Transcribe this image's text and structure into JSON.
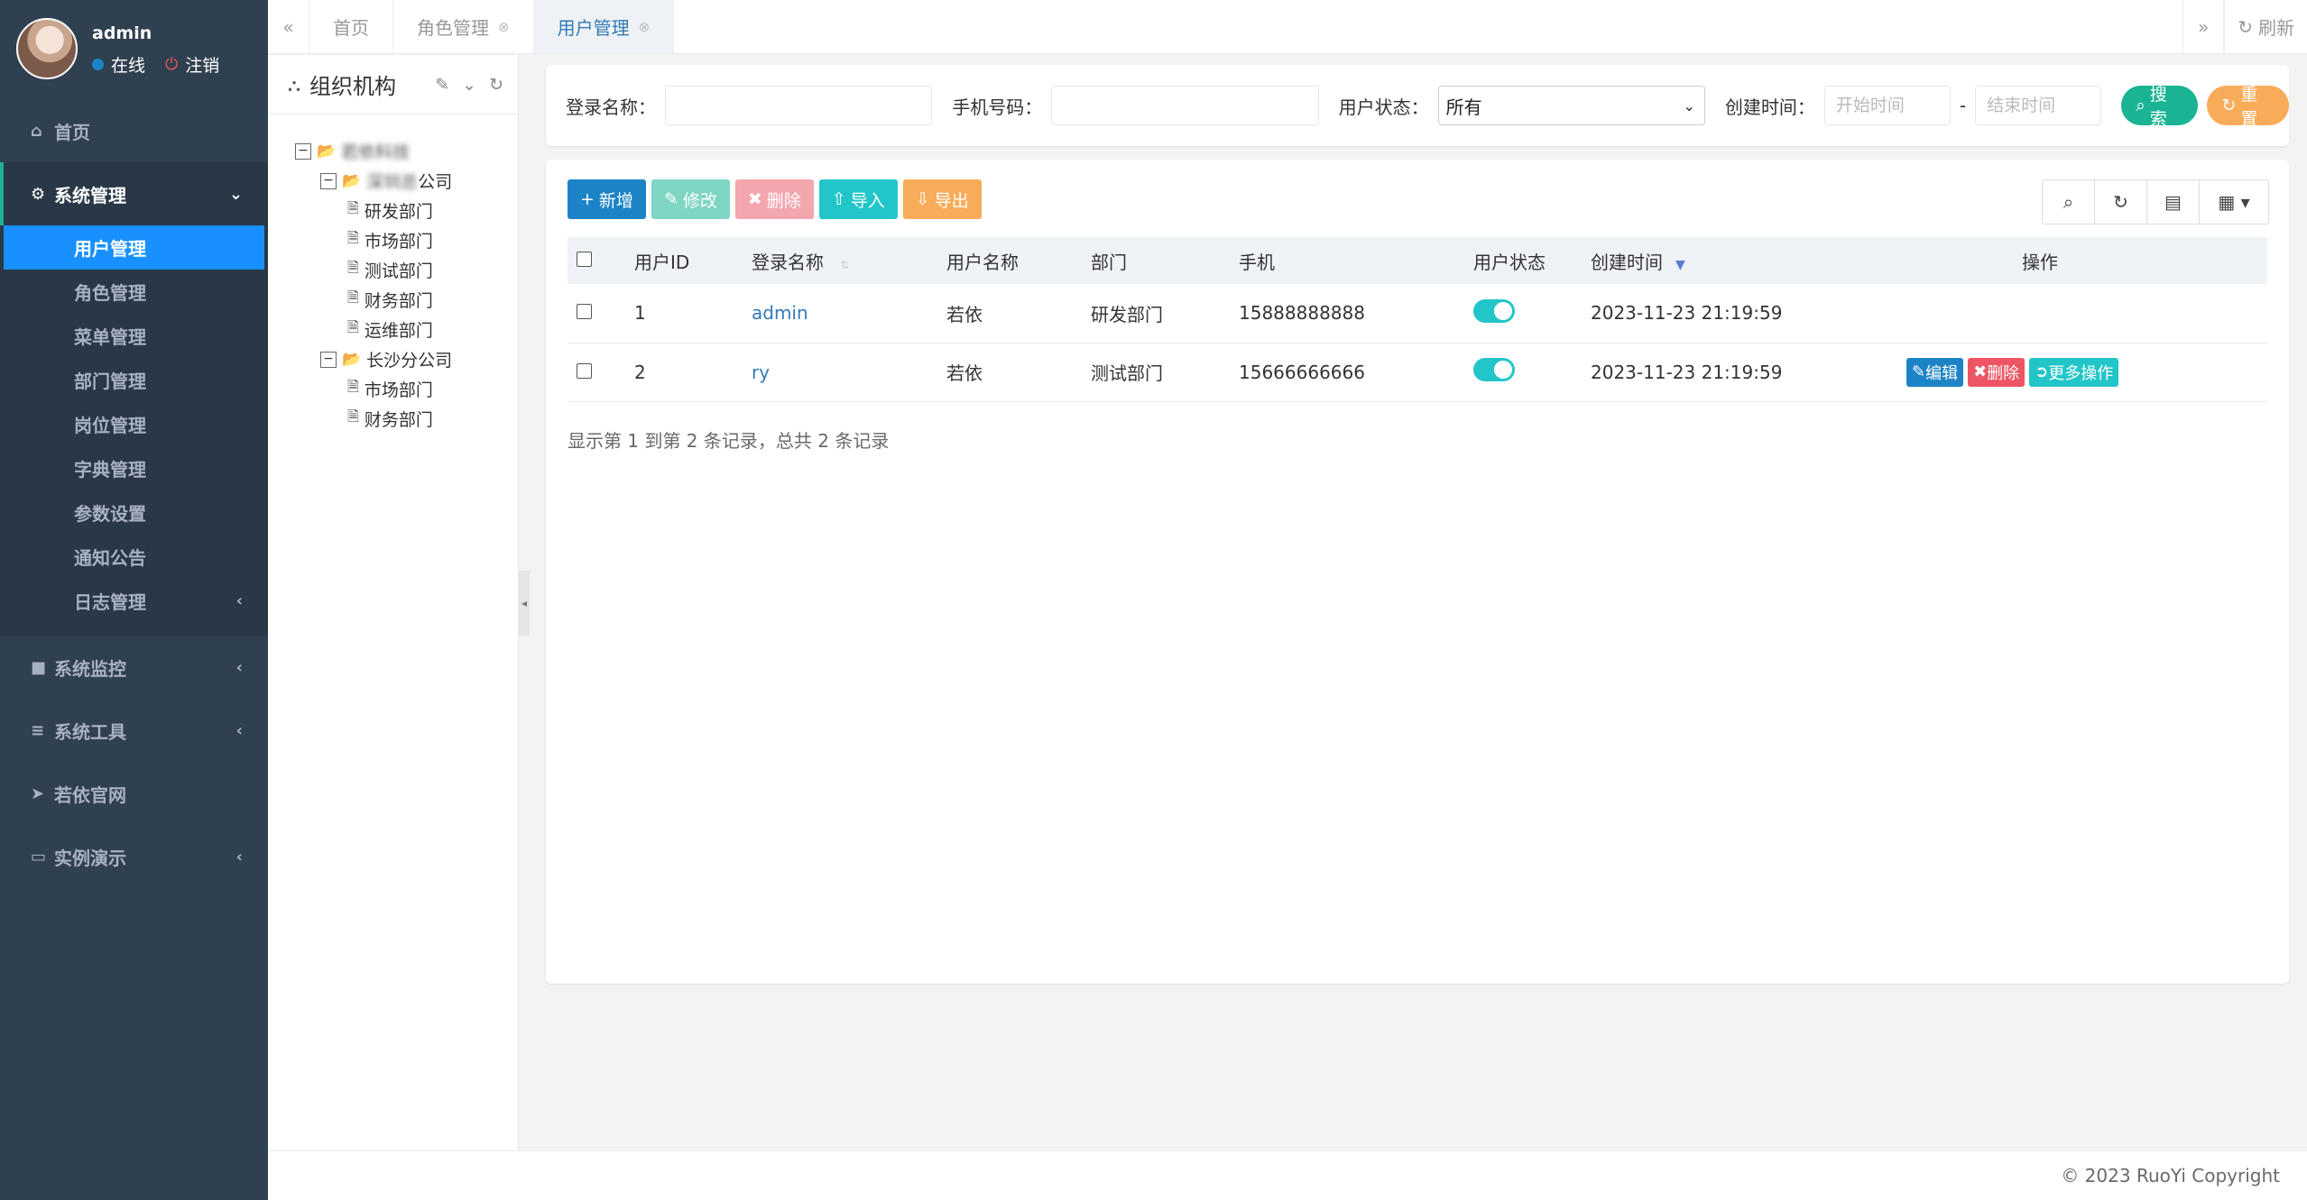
{
  "user": {
    "name": "admin",
    "status": "在线",
    "logout": "注销"
  },
  "sidebar": {
    "items": [
      {
        "label": "首页",
        "icon": "home-icon"
      },
      {
        "label": "系统管理",
        "icon": "gear-icon",
        "expanded": true,
        "children": [
          "用户管理",
          "角色管理",
          "菜单管理",
          "部门管理",
          "岗位管理",
          "字典管理",
          "参数设置",
          "通知公告",
          "日志管理"
        ]
      },
      {
        "label": "系统监控",
        "icon": "video-icon"
      },
      {
        "label": "系统工具",
        "icon": "bars-icon"
      },
      {
        "label": "若依官网",
        "icon": "send-icon"
      },
      {
        "label": "实例演示",
        "icon": "desktop-icon"
      }
    ],
    "active_child": "用户管理"
  },
  "tabs": {
    "items": [
      "首页",
      "角色管理",
      "用户管理"
    ],
    "active": "用户管理",
    "refresh": "刷新"
  },
  "org": {
    "title": "组织机构",
    "tree": [
      {
        "label": "若依科技",
        "level": 1,
        "type": "folder",
        "blurred": true
      },
      {
        "label": "深圳总公司",
        "level": 2,
        "type": "folder",
        "blurred_prefix": "深圳总",
        "suffix": "公司"
      },
      {
        "label": "研发部门",
        "level": 3,
        "type": "file"
      },
      {
        "label": "市场部门",
        "level": 3,
        "type": "file"
      },
      {
        "label": "测试部门",
        "level": 3,
        "type": "file"
      },
      {
        "label": "财务部门",
        "level": 3,
        "type": "file"
      },
      {
        "label": "运维部门",
        "level": 3,
        "type": "file"
      },
      {
        "label": "长沙分公司",
        "level": 2,
        "type": "folder"
      },
      {
        "label": "市场部门",
        "level": 3,
        "type": "file"
      },
      {
        "label": "财务部门",
        "level": 3,
        "type": "file"
      }
    ]
  },
  "search": {
    "login_name_label": "登录名称：",
    "phone_label": "手机号码：",
    "status_label": "用户状态：",
    "status_value": "所有",
    "created_label": "创建时间：",
    "start_placeholder": "开始时间",
    "end_placeholder": "结束时间",
    "range_sep": "-",
    "search_btn": "搜索",
    "reset_btn": "重置"
  },
  "toolbar": {
    "add": "新增",
    "edit": "修改",
    "delete": "删除",
    "import": "导入",
    "export": "导出"
  },
  "table": {
    "headers": [
      "用户ID",
      "登录名称",
      "用户名称",
      "部门",
      "手机",
      "用户状态",
      "创建时间",
      "操作"
    ],
    "rows": [
      {
        "id": "1",
        "login": "admin",
        "name": "若依",
        "dept": "研发部门",
        "phone": "15888888888",
        "enabled": true,
        "created": "2023-11-23 21:19:59"
      },
      {
        "id": "2",
        "login": "ry",
        "name": "若依",
        "dept": "测试部门",
        "phone": "15666666666",
        "enabled": true,
        "created": "2023-11-23 21:19:59",
        "ops": [
          "编辑",
          "删除",
          "更多操作"
        ]
      }
    ],
    "pager": "显示第 1 到第 2 条记录，总共 2 条记录"
  },
  "footer": {
    "copyright": "© 2023 RuoYi Copyright"
  },
  "colors": {
    "sidebar": "#2f4050",
    "active": "#1890ff",
    "primary": "#1c84c6",
    "success": "#1ab394",
    "warning": "#f8ac59",
    "danger": "#ed5565",
    "info": "#23c6c8"
  }
}
